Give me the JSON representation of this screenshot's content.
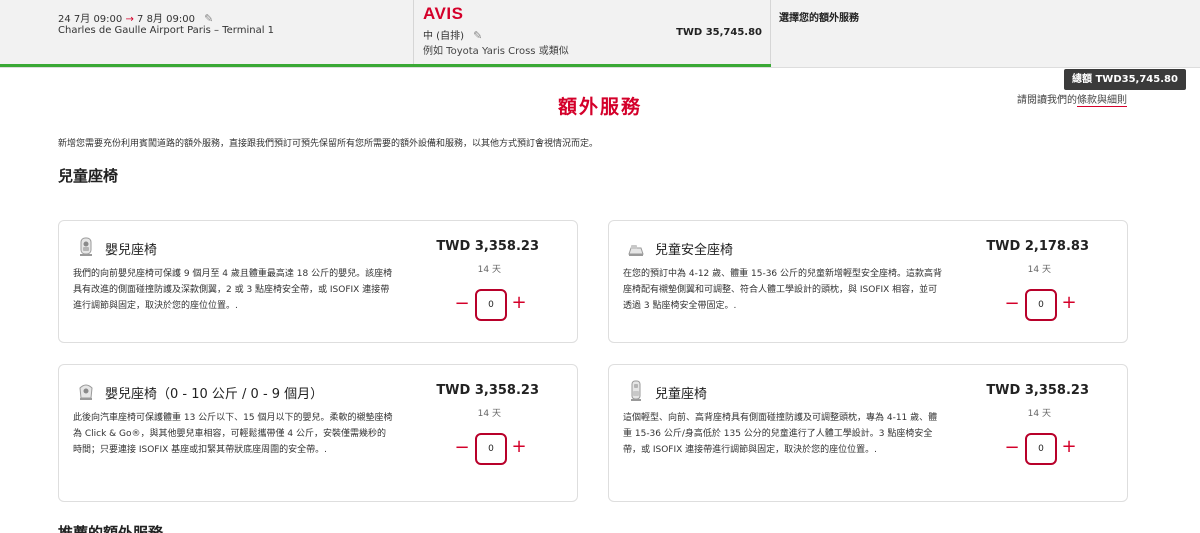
{
  "header": {
    "pickup_date": "24 7月 09:00",
    "return_date": "7 8月 09:00",
    "location": "Charles de Gaulle Airport Paris – Terminal 1",
    "brand": "AVIS",
    "car_class": "中 (自排)",
    "car_model": "例如 Toyota Yaris Cross 或類似",
    "car_price": "TWD 35,745.80",
    "step3_label": "選擇您的額外服務"
  },
  "total": {
    "label": "總額",
    "value": "TWD35,745.80"
  },
  "page": {
    "title": "額外服務",
    "terms_prefix": "請閱讀我們的",
    "terms_link": "條款與細則",
    "intro": "新增您需要充份利用賓闖道路的額外服務，直接跟我們預訂可預先保留所有您所需要的額外設備和服務，以其他方式預訂會視情況而定。",
    "section_child_seats": "兒童座椅",
    "section_recommended": "推薦的額外服務"
  },
  "cards": [
    {
      "title": "嬰兒座椅",
      "price": "TWD 3,358.23",
      "days": "14 天",
      "qty": "0",
      "desc": "我們的向前嬰兒座椅可保護 9 個月至 4 歲且體重最高達 18 公斤的嬰兒。該座椅具有改進的側面碰撞防護及深款側翼，2 或 3 點座椅安全帶，或 ISOFIX 連接帶進行調節與固定，取決於您的座位位置。."
    },
    {
      "title": "兒童安全座椅",
      "price": "TWD 2,178.83",
      "days": "14 天",
      "qty": "0",
      "desc": "在您的預訂中為 4-12 歲、體重 15-36 公斤的兒童新增輕型安全座椅。這款高背座椅配有襯墊側翼和可調整、符合人體工學設計的頭枕，與 ISOFIX 相容，並可透過 3 點座椅安全帶固定。."
    },
    {
      "title": "嬰兒座椅（0 - 10 公斤 / 0 - 9 個月）",
      "price": "TWD 3,358.23",
      "days": "14 天",
      "qty": "0",
      "desc": "此後向汽車座椅可保護體重 13 公斤以下、15 個月以下的嬰兒。柔軟的襯墊座椅為 Click & Go®，與其他嬰兒車相容，可輕鬆攜帶僅 4 公斤，安裝僅需幾秒的時間；只要連接 ISOFIX 基座或扣緊其帶狀底座周圍的安全帶。."
    },
    {
      "title": "兒童座椅",
      "price": "TWD 3,358.23",
      "days": "14 天",
      "qty": "0",
      "desc": "這個輕型、向前、高背座椅具有側面碰撞防護及可調整頭枕，專為 4-11 歲、體重 15-36 公斤/身高低於 135 公分的兒童進行了人體工學設計。3 點座椅安全帶，或 ISOFIX 連接帶進行調節與固定，取決於您的座位位置。."
    }
  ],
  "colors": {
    "accent": "#d4002a",
    "progress": "#3aa935"
  }
}
